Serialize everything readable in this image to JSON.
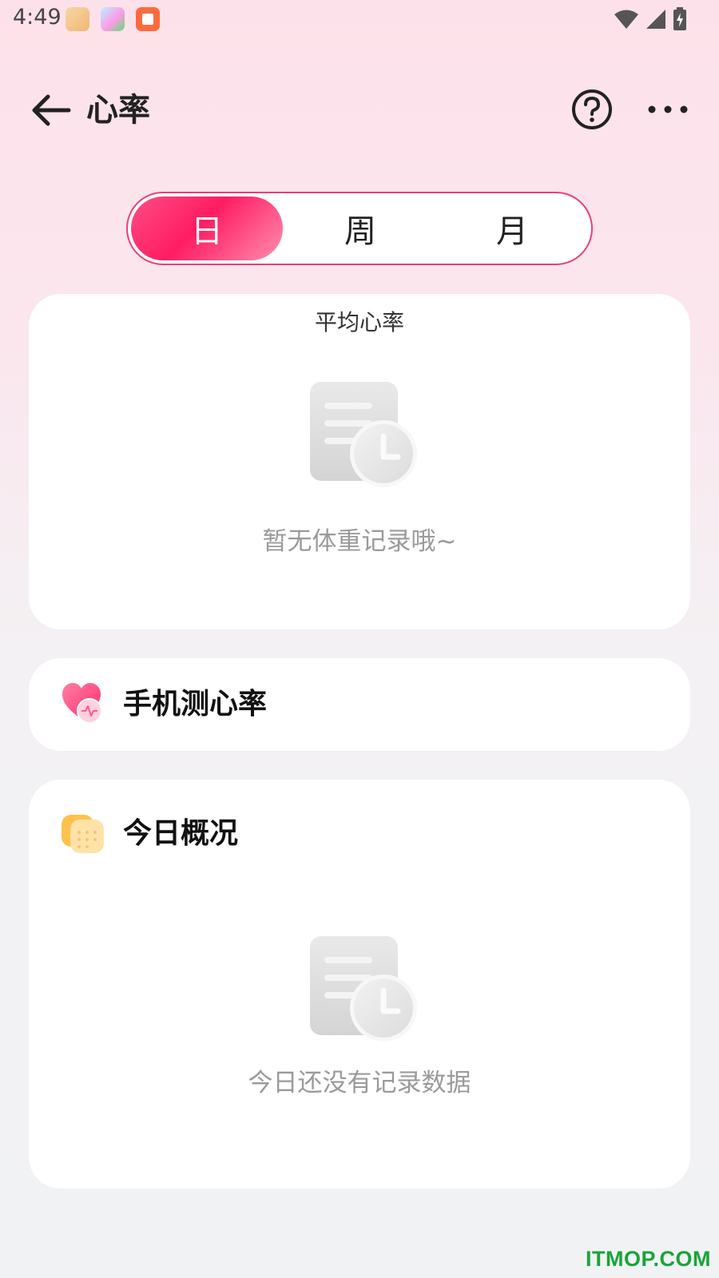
{
  "status_bar": {
    "time": "4:49",
    "icons": [
      "app-icon-cat",
      "app-icon-avatar",
      "app-icon-book",
      "wifi-icon",
      "signal-icon",
      "battery-charging-icon"
    ]
  },
  "header": {
    "title": "心率",
    "back_icon": "arrow-left-icon",
    "help_icon": "question-circle-icon",
    "more_icon": "more-horizontal-icon"
  },
  "tabs": [
    {
      "label": "日",
      "active": true
    },
    {
      "label": "周",
      "active": false
    },
    {
      "label": "月",
      "active": false
    }
  ],
  "average_card": {
    "title": "平均心率",
    "empty_text": "暂无体重记录哦~"
  },
  "measure_card": {
    "title": "手机测心率",
    "icon": "heart-pulse-icon"
  },
  "today_card": {
    "title": "今日概况",
    "icon": "calendar-icon",
    "empty_text": "今日还没有记录数据"
  },
  "watermark": "ITMOP.COM",
  "colors": {
    "accent": "#ff2d6a",
    "tab_border": "#ea3f72",
    "empty_text": "#9a9a9a",
    "watermark": "#1aa33a"
  }
}
